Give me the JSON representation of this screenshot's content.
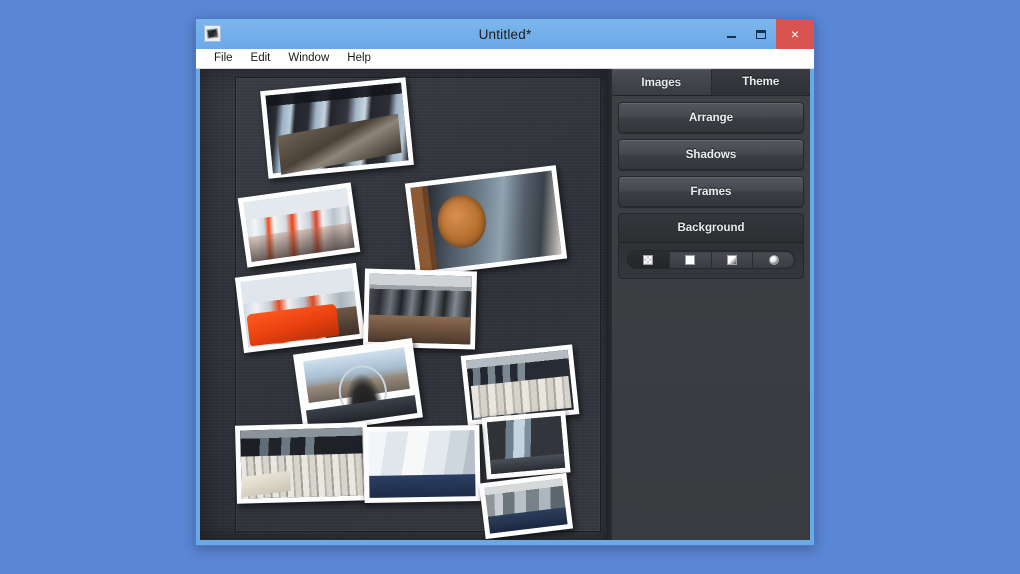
{
  "desktop": {
    "background_color": "#5b86d6"
  },
  "window": {
    "title": "Untitled*",
    "icon": "app-collage-icon",
    "accent_color": "#6aa8e8",
    "close_color": "#d9534f",
    "controls": {
      "minimize": "–",
      "maximize": "□",
      "close": "×"
    }
  },
  "menubar": {
    "items": [
      {
        "label": "File"
      },
      {
        "label": "Edit"
      },
      {
        "label": "Window"
      },
      {
        "label": "Help"
      }
    ]
  },
  "canvas": {
    "background_style": "dark-denim-texture",
    "background_color": "#2e3138",
    "photos": [
      {
        "name": "photo-boardroom-windows",
        "style": "im-boardroom"
      },
      {
        "name": "photo-cafeteria-red-chairs",
        "style": "im-cafeteria"
      },
      {
        "name": "photo-presentation-screen-logo",
        "style": "im-screen"
      },
      {
        "name": "photo-orange-sofa-lounge",
        "style": "im-sofa"
      },
      {
        "name": "photo-computer-lab-monitors",
        "style": "im-lab"
      },
      {
        "name": "photo-window-hanging-chair",
        "style": "im-window"
      },
      {
        "name": "photo-white-chairs-rows",
        "style": "im-chairs"
      },
      {
        "name": "photo-dark-doorway",
        "style": "im-door"
      },
      {
        "name": "photo-lecture-hall-seats",
        "style": "im-lecture"
      },
      {
        "name": "photo-white-room-blue-carpet",
        "style": "im-whiteroom"
      },
      {
        "name": "photo-hall-with-pods",
        "style": "im-hall"
      }
    ]
  },
  "panel": {
    "tabs": [
      {
        "label": "Images",
        "active": true
      },
      {
        "label": "Theme",
        "active": false
      }
    ],
    "buttons": [
      {
        "label": "Arrange"
      },
      {
        "label": "Shadows"
      },
      {
        "label": "Frames"
      }
    ],
    "background_section": {
      "title": "Background",
      "options": [
        {
          "name": "swatch-checker-transparent",
          "selected": true
        },
        {
          "name": "swatch-solid-white",
          "selected": false
        },
        {
          "name": "swatch-linear-gradient",
          "selected": false
        },
        {
          "name": "swatch-radial-gradient",
          "selected": false
        }
      ]
    }
  }
}
